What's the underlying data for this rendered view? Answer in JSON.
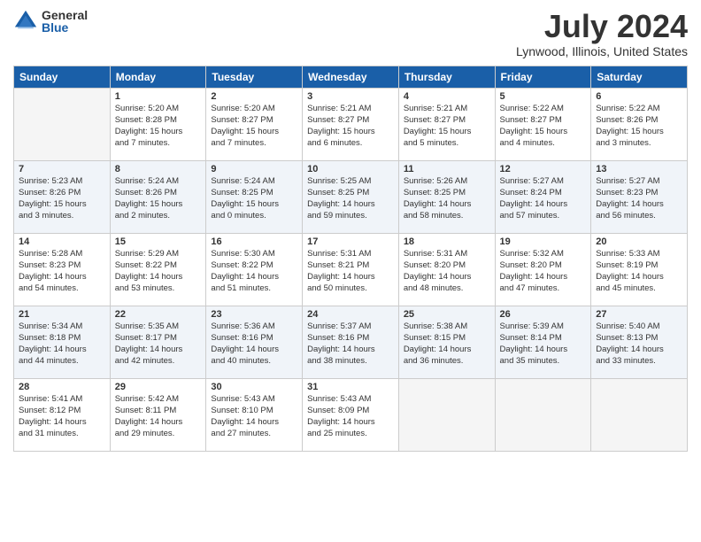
{
  "logo": {
    "general": "General",
    "blue": "Blue"
  },
  "title": "July 2024",
  "location": "Lynwood, Illinois, United States",
  "days_of_week": [
    "Sunday",
    "Monday",
    "Tuesday",
    "Wednesday",
    "Thursday",
    "Friday",
    "Saturday"
  ],
  "weeks": [
    [
      {
        "day": "",
        "info": ""
      },
      {
        "day": "1",
        "info": "Sunrise: 5:20 AM\nSunset: 8:28 PM\nDaylight: 15 hours\nand 7 minutes."
      },
      {
        "day": "2",
        "info": "Sunrise: 5:20 AM\nSunset: 8:27 PM\nDaylight: 15 hours\nand 7 minutes."
      },
      {
        "day": "3",
        "info": "Sunrise: 5:21 AM\nSunset: 8:27 PM\nDaylight: 15 hours\nand 6 minutes."
      },
      {
        "day": "4",
        "info": "Sunrise: 5:21 AM\nSunset: 8:27 PM\nDaylight: 15 hours\nand 5 minutes."
      },
      {
        "day": "5",
        "info": "Sunrise: 5:22 AM\nSunset: 8:27 PM\nDaylight: 15 hours\nand 4 minutes."
      },
      {
        "day": "6",
        "info": "Sunrise: 5:22 AM\nSunset: 8:26 PM\nDaylight: 15 hours\nand 3 minutes."
      }
    ],
    [
      {
        "day": "7",
        "info": "Sunrise: 5:23 AM\nSunset: 8:26 PM\nDaylight: 15 hours\nand 3 minutes."
      },
      {
        "day": "8",
        "info": "Sunrise: 5:24 AM\nSunset: 8:26 PM\nDaylight: 15 hours\nand 2 minutes."
      },
      {
        "day": "9",
        "info": "Sunrise: 5:24 AM\nSunset: 8:25 PM\nDaylight: 15 hours\nand 0 minutes."
      },
      {
        "day": "10",
        "info": "Sunrise: 5:25 AM\nSunset: 8:25 PM\nDaylight: 14 hours\nand 59 minutes."
      },
      {
        "day": "11",
        "info": "Sunrise: 5:26 AM\nSunset: 8:25 PM\nDaylight: 14 hours\nand 58 minutes."
      },
      {
        "day": "12",
        "info": "Sunrise: 5:27 AM\nSunset: 8:24 PM\nDaylight: 14 hours\nand 57 minutes."
      },
      {
        "day": "13",
        "info": "Sunrise: 5:27 AM\nSunset: 8:23 PM\nDaylight: 14 hours\nand 56 minutes."
      }
    ],
    [
      {
        "day": "14",
        "info": "Sunrise: 5:28 AM\nSunset: 8:23 PM\nDaylight: 14 hours\nand 54 minutes."
      },
      {
        "day": "15",
        "info": "Sunrise: 5:29 AM\nSunset: 8:22 PM\nDaylight: 14 hours\nand 53 minutes."
      },
      {
        "day": "16",
        "info": "Sunrise: 5:30 AM\nSunset: 8:22 PM\nDaylight: 14 hours\nand 51 minutes."
      },
      {
        "day": "17",
        "info": "Sunrise: 5:31 AM\nSunset: 8:21 PM\nDaylight: 14 hours\nand 50 minutes."
      },
      {
        "day": "18",
        "info": "Sunrise: 5:31 AM\nSunset: 8:20 PM\nDaylight: 14 hours\nand 48 minutes."
      },
      {
        "day": "19",
        "info": "Sunrise: 5:32 AM\nSunset: 8:20 PM\nDaylight: 14 hours\nand 47 minutes."
      },
      {
        "day": "20",
        "info": "Sunrise: 5:33 AM\nSunset: 8:19 PM\nDaylight: 14 hours\nand 45 minutes."
      }
    ],
    [
      {
        "day": "21",
        "info": "Sunrise: 5:34 AM\nSunset: 8:18 PM\nDaylight: 14 hours\nand 44 minutes."
      },
      {
        "day": "22",
        "info": "Sunrise: 5:35 AM\nSunset: 8:17 PM\nDaylight: 14 hours\nand 42 minutes."
      },
      {
        "day": "23",
        "info": "Sunrise: 5:36 AM\nSunset: 8:16 PM\nDaylight: 14 hours\nand 40 minutes."
      },
      {
        "day": "24",
        "info": "Sunrise: 5:37 AM\nSunset: 8:16 PM\nDaylight: 14 hours\nand 38 minutes."
      },
      {
        "day": "25",
        "info": "Sunrise: 5:38 AM\nSunset: 8:15 PM\nDaylight: 14 hours\nand 36 minutes."
      },
      {
        "day": "26",
        "info": "Sunrise: 5:39 AM\nSunset: 8:14 PM\nDaylight: 14 hours\nand 35 minutes."
      },
      {
        "day": "27",
        "info": "Sunrise: 5:40 AM\nSunset: 8:13 PM\nDaylight: 14 hours\nand 33 minutes."
      }
    ],
    [
      {
        "day": "28",
        "info": "Sunrise: 5:41 AM\nSunset: 8:12 PM\nDaylight: 14 hours\nand 31 minutes."
      },
      {
        "day": "29",
        "info": "Sunrise: 5:42 AM\nSunset: 8:11 PM\nDaylight: 14 hours\nand 29 minutes."
      },
      {
        "day": "30",
        "info": "Sunrise: 5:43 AM\nSunset: 8:10 PM\nDaylight: 14 hours\nand 27 minutes."
      },
      {
        "day": "31",
        "info": "Sunrise: 5:43 AM\nSunset: 8:09 PM\nDaylight: 14 hours\nand 25 minutes."
      },
      {
        "day": "",
        "info": ""
      },
      {
        "day": "",
        "info": ""
      },
      {
        "day": "",
        "info": ""
      }
    ]
  ]
}
